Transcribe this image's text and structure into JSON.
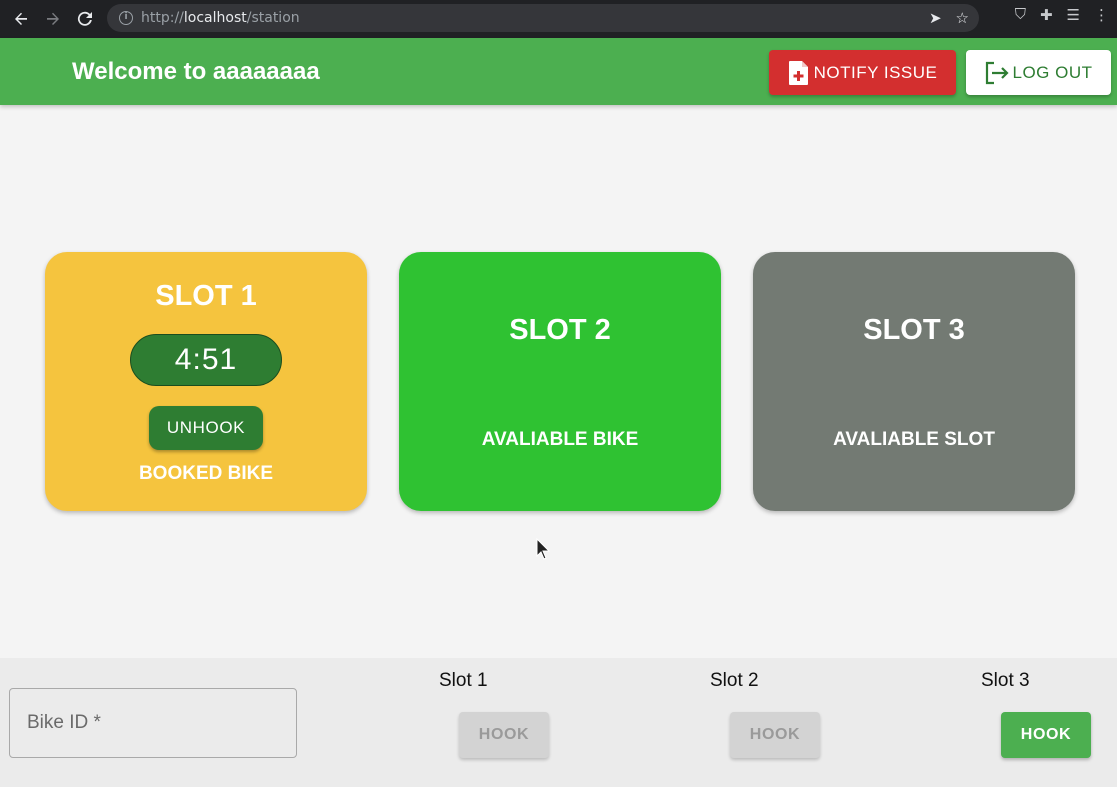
{
  "browser": {
    "url_scheme": "http://",
    "url_host": "localhost",
    "url_path": "/station"
  },
  "header": {
    "welcome": "Welcome to aaaaaaaa",
    "notify_label": "NOTIFY ISSUE",
    "logout_label": "LOG OUT"
  },
  "slots": [
    {
      "title": "SLOT 1",
      "timer": "4:51",
      "action": "UNHOOK",
      "status": "BOOKED BIKE",
      "color": "#f5c43e"
    },
    {
      "title": "SLOT 2",
      "status": "AVALIABLE BIKE",
      "color": "#2fc232"
    },
    {
      "title": "SLOT 3",
      "status": "AVALIABLE SLOT",
      "color": "#737a73"
    }
  ],
  "bottom": {
    "bike_id_placeholder": "Bike ID *",
    "slots": [
      {
        "label": "Slot 1",
        "button": "HOOK",
        "enabled": false
      },
      {
        "label": "Slot 2",
        "button": "HOOK",
        "enabled": false
      },
      {
        "label": "Slot 3",
        "button": "HOOK",
        "enabled": true
      }
    ]
  },
  "colors": {
    "appbar": "#4caf50",
    "notify": "#d32f2f",
    "dark_green": "#2e7d32"
  }
}
